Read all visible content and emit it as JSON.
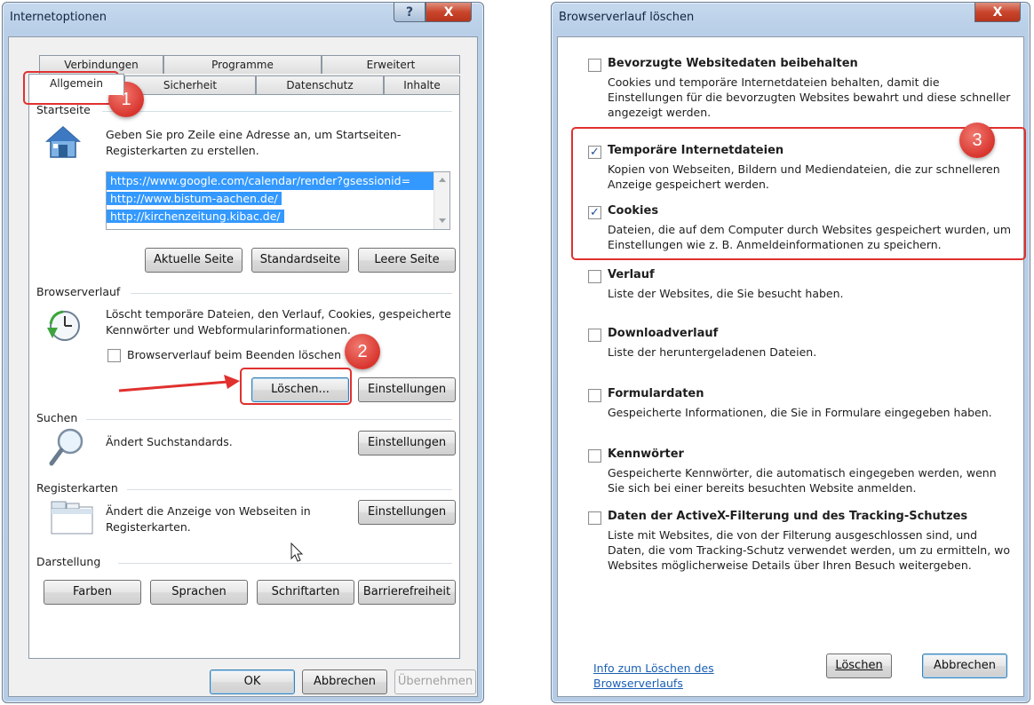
{
  "colors": {
    "highlight_red": "#e0312f",
    "accent_link": "#1a5fb4",
    "selection_blue": "#3399ff"
  },
  "left_dialog": {
    "title": "Internetoptionen",
    "tabs_row1": [
      "Verbindungen",
      "Programme",
      "Erweitert"
    ],
    "tabs_row2": [
      "Allgemein",
      "Sicherheit",
      "Datenschutz",
      "Inhalte"
    ],
    "active_tab": "Allgemein",
    "startseite": {
      "label": "Startseite",
      "desc": "Geben Sie pro Zeile eine Adresse an, um Startseiten-Registerkarten zu erstellen.",
      "urls": [
        "https://www.google.com/calendar/render?gsessionid=",
        "http://www.bistum-aachen.de/",
        "http://kirchenzeitung.kibac.de/"
      ],
      "buttons": [
        "Aktuelle Seite",
        "Standardseite",
        "Leere Seite"
      ]
    },
    "browserverlauf": {
      "label": "Browserverlauf",
      "desc": "Löscht temporäre Dateien, den Verlauf, Cookies, gespeicherte Kennwörter und Webformularinformationen.",
      "checkbox_label": "Browserverlauf beim Beenden löschen",
      "delete_button": "Löschen...",
      "settings_button": "Einstellungen"
    },
    "suchen": {
      "label": "Suchen",
      "desc": "Ändert Suchstandards.",
      "settings_button": "Einstellungen"
    },
    "registerkarten": {
      "label": "Registerkarten",
      "desc": "Ändert die Anzeige von Webseiten in Registerkarten.",
      "settings_button": "Einstellungen"
    },
    "darstellung": {
      "label": "Darstellung",
      "buttons": [
        "Farben",
        "Sprachen",
        "Schriftarten",
        "Barrierefreiheit"
      ]
    },
    "footer": {
      "ok": "OK",
      "cancel": "Abbrechen",
      "apply": "Übernehmen"
    }
  },
  "right_dialog": {
    "title": "Browserverlauf löschen",
    "options": [
      {
        "title": "Bevorzugte Websitedaten beibehalten",
        "checked": false,
        "desc": "Cookies und temporäre Internetdateien behalten, damit die Einstellungen für die bevorzugten Websites bewahrt und diese schneller angezeigt werden."
      },
      {
        "title": "Temporäre Internetdateien",
        "checked": true,
        "desc": "Kopien von Webseiten, Bildern und Mediendateien, die zur schnelleren Anzeige gespeichert werden."
      },
      {
        "title": "Cookies",
        "checked": true,
        "desc": "Dateien, die auf dem Computer durch Websites gespeichert wurden, um Einstellungen wie z. B. Anmeldeinformationen zu speichern."
      },
      {
        "title": "Verlauf",
        "checked": false,
        "desc": "Liste der Websites, die Sie besucht haben."
      },
      {
        "title": "Downloadverlauf",
        "checked": false,
        "desc": "Liste der heruntergeladenen Dateien."
      },
      {
        "title": "Formulardaten",
        "checked": false,
        "desc": "Gespeicherte Informationen, die Sie in Formulare eingegeben haben."
      },
      {
        "title": "Kennwörter",
        "checked": false,
        "desc": "Gespeicherte Kennwörter, die automatisch eingegeben werden, wenn Sie sich bei einer bereits besuchten Website anmelden."
      },
      {
        "title": "Daten der ActiveX-Filterung und des Tracking-Schutzes",
        "checked": false,
        "desc": "Liste mit Websites, die von der Filterung ausgeschlossen sind, und Daten, die vom Tracking-Schutz verwendet werden, um zu ermitteln, wo Websites möglicherweise Details über Ihren Besuch weitergeben."
      }
    ],
    "info_link": "Info zum Löschen des Browserverlaufs",
    "delete_button": "Löschen",
    "cancel_button": "Abbrechen"
  },
  "annotations": {
    "step1": "1",
    "step2": "2",
    "step3": "3"
  },
  "window_controls": {
    "help": "?",
    "close": "X"
  }
}
